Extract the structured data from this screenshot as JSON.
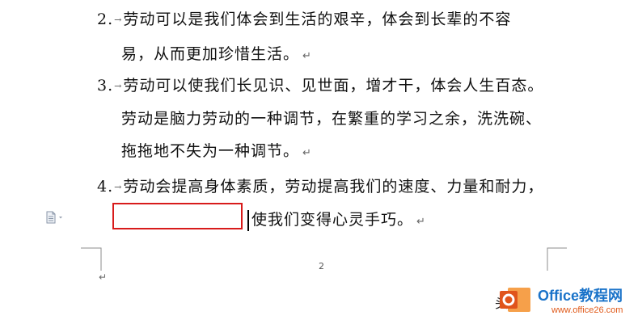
{
  "document": {
    "items": [
      {
        "number": "2.",
        "lines": [
          "劳动可以是我们体会到生活的艰辛，体会到长辈的不容",
          "易，从而更加珍惜生活。"
        ]
      },
      {
        "number": "3.",
        "lines": [
          "劳动可以使我们长见识、见世面，增才干，体会人生百态。",
          "劳动是脑力劳动的一种调节，在繁重的学习之余，洗洗碗、",
          "拖拖地不失为一种调节。"
        ]
      },
      {
        "number": "4.",
        "lines": [
          "劳动会提高身体素质，劳动提高我们的速度、力量和耐力，",
          "使我们变得心灵手巧。"
        ]
      }
    ],
    "tab_arrow": "→",
    "paragraph_mark": "↵",
    "page_number": "2"
  },
  "watermark": {
    "prefix": "头条",
    "logo_title": "Office教程网",
    "logo_url": "www.office26.com"
  },
  "colors": {
    "highlight_box": "#d81b1b",
    "logo_blue": "#1a73c9",
    "logo_orange": "#e05a1a"
  },
  "icons": [
    "document-options-icon"
  ]
}
